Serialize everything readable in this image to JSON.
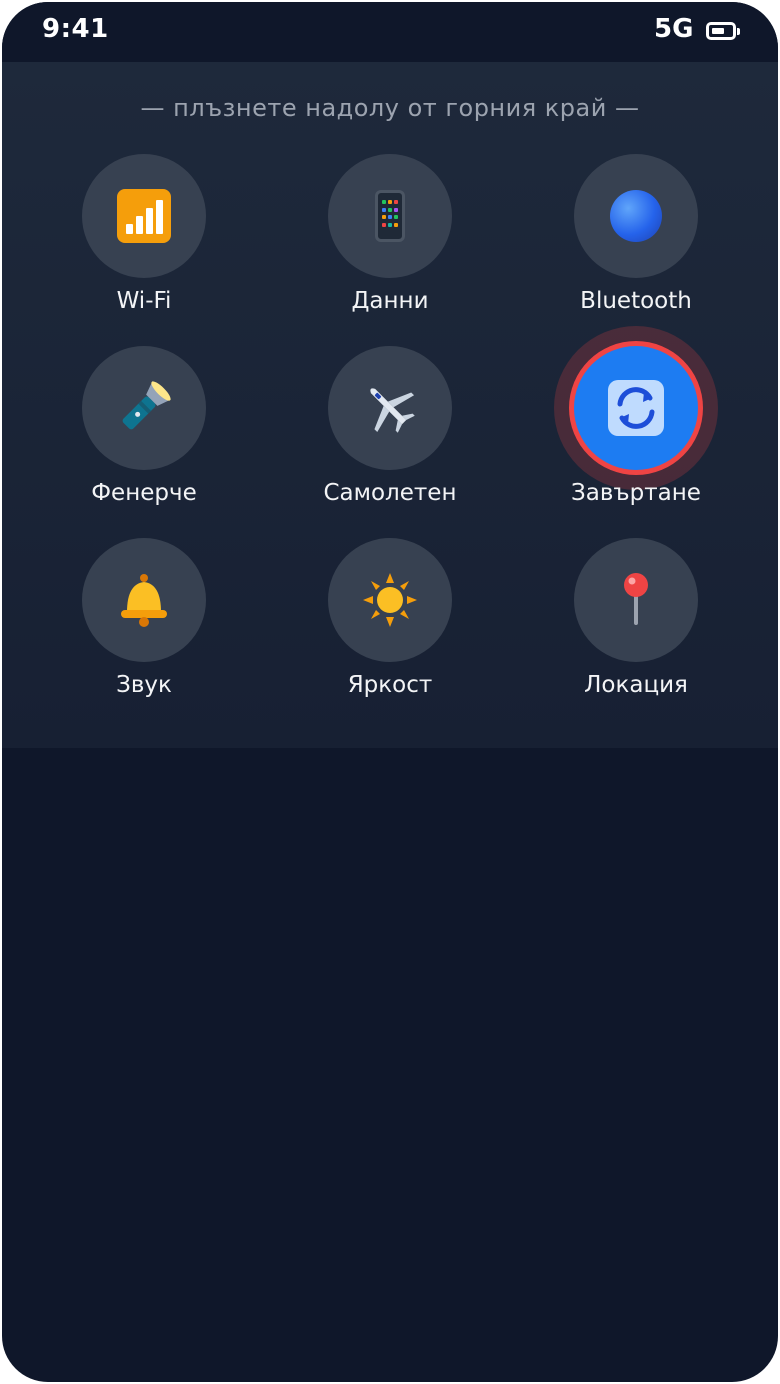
{
  "status_bar": {
    "time": "9:41",
    "network": "5G"
  },
  "panel": {
    "hint": "— плъзнете надолу от горния край —"
  },
  "tiles": [
    {
      "label": "Wi-Fi",
      "icon": "wifi-signal-icon",
      "active": false
    },
    {
      "label": "Данни",
      "icon": "mobile-data-icon",
      "active": false
    },
    {
      "label": "Bluetooth",
      "icon": "bluetooth-icon",
      "active": false
    },
    {
      "label": "Фенерче",
      "icon": "flashlight-icon",
      "active": false
    },
    {
      "label": "Самолетен",
      "icon": "airplane-icon",
      "active": false
    },
    {
      "label": "Завъртане",
      "icon": "rotate-icon",
      "active": true
    },
    {
      "label": "Звук",
      "icon": "bell-icon",
      "active": false
    },
    {
      "label": "Яркост",
      "icon": "sun-icon",
      "active": false
    },
    {
      "label": "Локация",
      "icon": "location-pin-icon",
      "active": false
    }
  ],
  "colors": {
    "background": "#0f172a",
    "panel": "#1e293b",
    "tile": "#374151",
    "active_tile": "#1d7cf2",
    "highlight_ring": "#ef4444"
  }
}
